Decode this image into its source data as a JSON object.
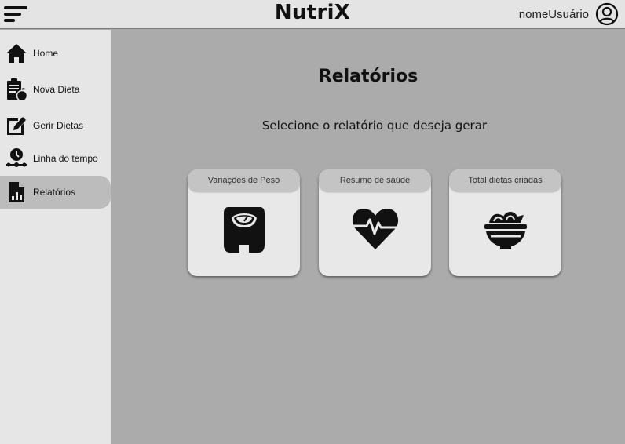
{
  "header": {
    "brand": "NutriX",
    "user_name": "nomeUsuário",
    "menu_icon": "hamburger-menu-icon",
    "user_icon": "user-circle-icon"
  },
  "sidebar": {
    "items": [
      {
        "label": "Home",
        "icon": "home-icon",
        "active": false
      },
      {
        "label": "Nova Dieta",
        "icon": "clipboard-apple-icon",
        "active": false
      },
      {
        "label": "Gerir Dietas",
        "icon": "edit-document-icon",
        "active": false
      },
      {
        "label": "Linha do tempo",
        "icon": "timeline-icon",
        "active": false
      },
      {
        "label": "Relatórios",
        "icon": "report-chart-icon",
        "active": true
      }
    ]
  },
  "main": {
    "title": "Relatórios",
    "subtitle": "Selecione o relatório que deseja gerar",
    "cards": [
      {
        "label": "Variações de Peso",
        "icon": "scale-icon"
      },
      {
        "label": "Resumo de saúde",
        "icon": "heart-pulse-icon"
      },
      {
        "label": "Total dietas criadas",
        "icon": "salad-bowl-icon"
      }
    ]
  },
  "colors": {
    "background": "#ababab",
    "topbar": "#e4e4e4",
    "sidebar": "#e6e6e6",
    "active_item": "#bcbcbc",
    "card": "#e8e8e8",
    "card_header": "#c4c4c4"
  }
}
